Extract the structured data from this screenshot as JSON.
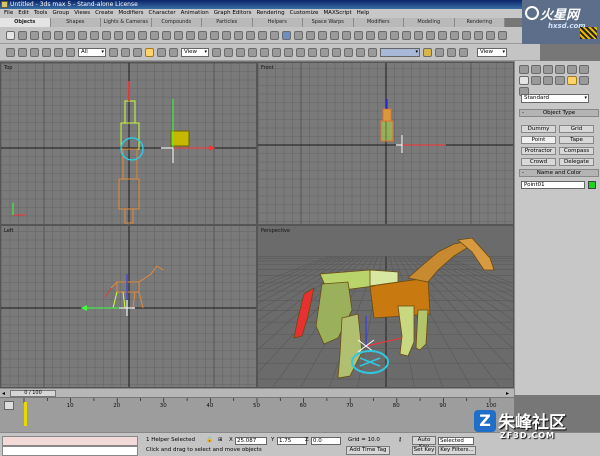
{
  "window": {
    "title": "Untitled - 3ds max 5 - Stand-alone License"
  },
  "menu": [
    "File",
    "Edit",
    "Tools",
    "Group",
    "Views",
    "Create",
    "Modifiers",
    "Character",
    "Animation",
    "Graph Editors",
    "Rendering",
    "Customize",
    "MAXScript",
    "Help"
  ],
  "tabs": [
    "Objects",
    "Shapes",
    "Lights & Cameras",
    "Compounds",
    "Particles",
    "Helpers",
    "Space Warps",
    "Modifiers",
    "Modeling",
    "Rendering"
  ],
  "toolbar": {
    "selection_filter": "All",
    "ref_coord": "View",
    "ref_coord2": "View",
    "named_sel": ""
  },
  "logo": {
    "title": "火星网",
    "url": "hxsd.com"
  },
  "viewports": {
    "top": "Top",
    "front": "Front",
    "left": "Left",
    "perspective": "Perspective"
  },
  "command_panel": {
    "dropdown": "Standard",
    "object_type_title": "Object Type",
    "autogrid": "",
    "buttons": [
      "Dummy",
      "Grid",
      "Point",
      "Tape",
      "Protractor",
      "Compass",
      "Crowd",
      "Delegate"
    ],
    "name_color_title": "Name and Color",
    "object_name": "Point01",
    "object_color": "#1fd21f"
  },
  "timeline": {
    "slider_label": "0 / 100",
    "ticks": [
      "0",
      "10",
      "20",
      "30",
      "40",
      "50",
      "60",
      "70",
      "80",
      "90",
      "100"
    ],
    "current_frame": 0
  },
  "status": {
    "selection": "1 Helper Selected",
    "prompt": "Click and drag to select and move objects",
    "x_label": "X",
    "x": "25.087",
    "y_label": "Y",
    "y": "1.75",
    "z_label": "Z",
    "z": "0.0",
    "grid": "Grid = 10.0",
    "add_time_tag": "Add Time Tag",
    "auto_key": "Auto Key",
    "set_key": "Set Key",
    "selected": "Selected",
    "key_filters": "Key Filters..."
  },
  "watermark": {
    "name": "朱峰社区",
    "url": "ZF3D.COM",
    "mark": "Z"
  }
}
